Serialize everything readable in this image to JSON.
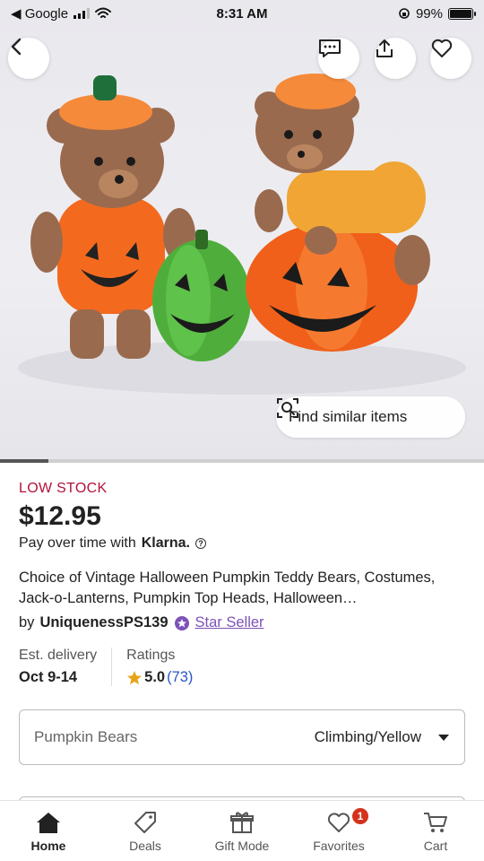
{
  "status_bar": {
    "back_app": "Google",
    "time": "8:31 AM",
    "battery": "99%",
    "battery_level": 0.99
  },
  "image_carousel": {
    "progress": 0.1,
    "find_similar_label": "Find similar items"
  },
  "listing": {
    "stock_label": "LOW STOCK",
    "price": "$12.95",
    "klarna_text": "Pay over time with",
    "klarna_brand": "Klarna.",
    "title": "Choice of Vintage Halloween Pumpkin Teddy Bears, Costumes, Jack-o-Lanterns, Pumpkin Top Heads, Halloween…",
    "seller_prefix": "by",
    "seller_name": "UniquenessPS139",
    "seller_badge": "Star Seller",
    "delivery_label": "Est. delivery",
    "delivery_value": "Oct 9-14",
    "ratings_label": "Ratings",
    "rating_value": "5.0",
    "rating_count": "(73)"
  },
  "variant_select": {
    "label": "Pumpkin Bears",
    "selected": "Climbing/Yellow"
  },
  "tab_bar": {
    "items": [
      {
        "label": "Home",
        "icon": "home-icon"
      },
      {
        "label": "Deals",
        "icon": "tag-icon"
      },
      {
        "label": "Gift Mode",
        "icon": "gift-icon"
      },
      {
        "label": "Favorites",
        "icon": "heart-icon",
        "badge": "1"
      },
      {
        "label": "Cart",
        "icon": "cart-icon"
      }
    ]
  },
  "colors": {
    "low_stock": "#b3113a",
    "star_seller": "#7e52b8",
    "rating_count": "#2a56c6",
    "badge": "#d4321c",
    "star": "#e8a317"
  }
}
